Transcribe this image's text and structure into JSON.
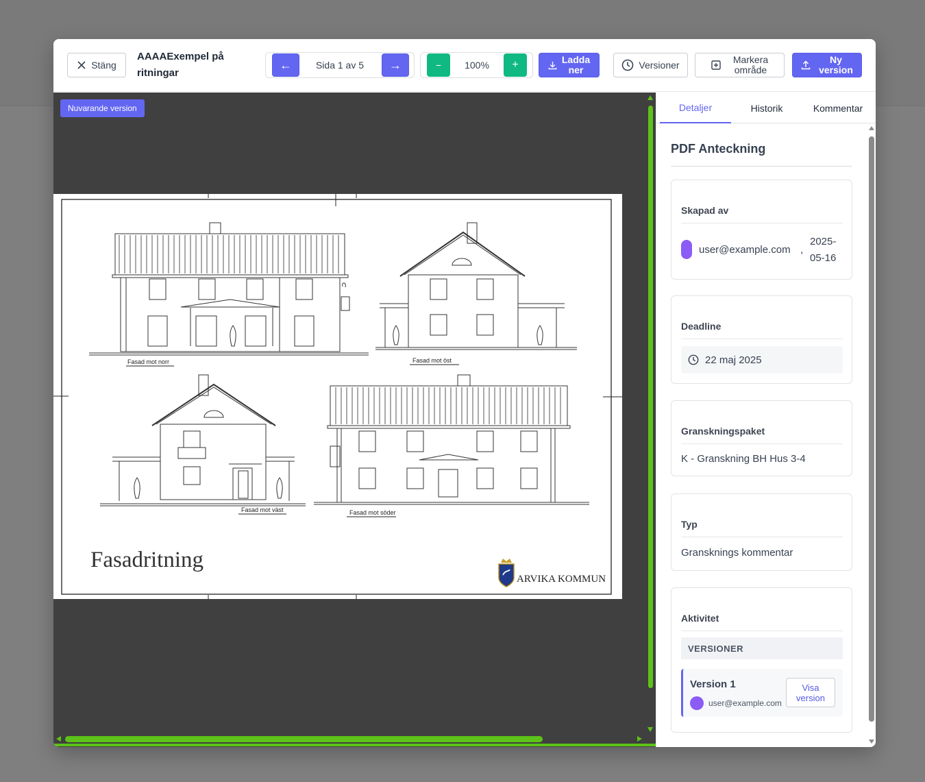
{
  "toolbar": {
    "close_label": "Stäng",
    "document_title": "AAAAExempel på ritningar",
    "prev_label": "←",
    "next_label": "→",
    "page_indicator": "Sida 1 av 5",
    "zoom_out_label": "−",
    "zoom_level": "100%",
    "zoom_in_label": "+",
    "download_label_1": "Ladda",
    "download_label_2": "ner",
    "versions_label": "Versioner",
    "mark_area_label_1": "Markera",
    "mark_area_label_2": "område",
    "new_version_label_1": "Ny",
    "new_version_label_2": "version"
  },
  "viewer": {
    "current_version_badge": "Nuvarande version",
    "drawing_title": "Fasadritning",
    "elevation_labels": [
      "Fasad mot norr",
      "Fasad mot öst",
      "Fasad mot väst",
      "Fasad mot söder"
    ],
    "logo_text": "ARVIKA KOMMUN"
  },
  "sidebar": {
    "tabs": [
      "Detaljer",
      "Historik",
      "Kommentar"
    ],
    "active_tab": "Detaljer",
    "section_title": "PDF Anteckning",
    "created_by": {
      "label": "Skapad av",
      "user": "user@example.com",
      "separator": ",",
      "date_1": "2025-",
      "date_2": "05-16"
    },
    "deadline": {
      "label": "Deadline",
      "value": "22 maj 2025"
    },
    "review_package": {
      "label": "Granskningspaket",
      "value": "K - Granskning BH Hus 3-4"
    },
    "type": {
      "label": "Typ",
      "value": "Gransknings kommentar"
    },
    "activity": {
      "label": "Aktivitet",
      "versions_header": "VERSIONER",
      "version_name": "Version 1",
      "version_user": "user@example.com",
      "view_version_label_1": "Visa",
      "view_version_label_2": "version"
    }
  },
  "colors": {
    "accent": "#6366f1",
    "green": "#10b981",
    "scrollbar": "#5dc219",
    "avatar": "#8b5cf6"
  },
  "icons": [
    "close-icon",
    "arrow-left-icon",
    "arrow-right-icon",
    "minus-icon",
    "plus-icon",
    "download-icon",
    "clock-icon",
    "plus-square-icon",
    "upload-icon"
  ]
}
